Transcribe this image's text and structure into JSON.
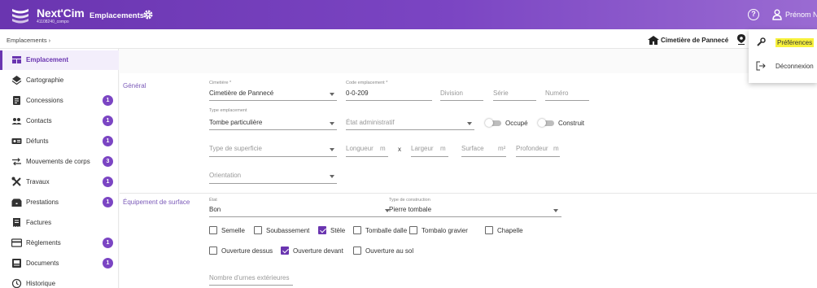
{
  "header": {
    "brand": "Next'Cim",
    "brand_sub": "41108240_compo",
    "module": "Emplacements",
    "user_name": "Prénom N."
  },
  "breadcrumb": "Emplacements  ›",
  "cemetery_name": "Cimetière de Pannecé",
  "user_menu": [
    {
      "label": "Préférences",
      "icon": "wrench-icon"
    },
    {
      "label": "Déconnexion",
      "icon": "logout-icon"
    }
  ],
  "sidebar": {
    "items": [
      {
        "label": "Emplacement",
        "icon": "grid-icon",
        "badge": ""
      },
      {
        "label": "Cartographie",
        "icon": "layers-icon",
        "badge": ""
      },
      {
        "label": "Concessions",
        "icon": "document-icon",
        "badge": "1"
      },
      {
        "label": "Contacts",
        "icon": "people-icon",
        "badge": "1"
      },
      {
        "label": "Défunts",
        "icon": "id-card-icon",
        "badge": "1"
      },
      {
        "label": "Mouvements de corps",
        "icon": "swap-icon",
        "badge": "3"
      },
      {
        "label": "Travaux",
        "icon": "tools-icon",
        "badge": "1"
      },
      {
        "label": "Prestations",
        "icon": "toolbox-icon",
        "badge": "1"
      },
      {
        "label": "Factures",
        "icon": "invoice-icon",
        "badge": ""
      },
      {
        "label": "Règlements",
        "icon": "card-icon",
        "badge": "1"
      },
      {
        "label": "Documents",
        "icon": "folder-icon",
        "badge": "1"
      },
      {
        "label": "Historique",
        "icon": "history-icon",
        "badge": ""
      }
    ]
  },
  "general": {
    "section_label": "Général",
    "cimetiere_label": "Cimetière *",
    "cimetiere_value": "Cimetière de Pannecé",
    "code_label": "Code emplacement *",
    "code_value": "0-0-209",
    "division_ph": "Division",
    "serie_ph": "Série",
    "numero_ph": "Numéro",
    "type_label": "Type emplacement",
    "type_value": "Tombe particulière",
    "etat_admin_ph": "État administratif",
    "occupe_label": "Occupé",
    "construit_label": "Construit",
    "type_superficie_ph": "Type de superficie",
    "longueur_ph": "Longueur",
    "unit_m": "m",
    "x": "x",
    "largeur_ph": "Largeur",
    "surface_ph": "Surface",
    "unit_m2": "m²",
    "profondeur_ph": "Profondeur",
    "orientation_ph": "Orientation"
  },
  "equipement": {
    "section_label": "Équipement de surface",
    "etat_label": "État",
    "etat_value": "Bon",
    "type_construction_label": "Type de construction",
    "type_construction_value": "Pierre tombale",
    "checkboxes_row1": [
      {
        "label": "Semelle",
        "checked": false
      },
      {
        "label": "Soubassement",
        "checked": false
      },
      {
        "label": "Stèle",
        "checked": true
      },
      {
        "label": "Tomballe dalle",
        "checked": false
      },
      {
        "label": "Tombalo gravier",
        "checked": false
      },
      {
        "label": "Chapelle",
        "checked": false
      }
    ],
    "checkboxes_row2": [
      {
        "label": "Ouverture dessus",
        "checked": false
      },
      {
        "label": "Ouverture devant",
        "checked": true
      },
      {
        "label": "Ouverture au sol",
        "checked": false
      }
    ],
    "nombre_urnes_ph": "Nombre d'urnes extérieures"
  },
  "colors": {
    "brand": "#6a35b0",
    "highlight": "#f7f13b"
  }
}
